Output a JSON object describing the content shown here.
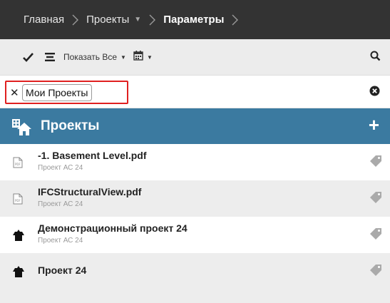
{
  "breadcrumb": {
    "home": "Главная",
    "projects": "Проекты",
    "current": "Параметры"
  },
  "toolbar": {
    "show_all_label": "Показать Все"
  },
  "filter": {
    "chip_label": "Мои Проекты"
  },
  "section": {
    "title": "Проекты",
    "add_symbol": "+"
  },
  "items": [
    {
      "title": "-1. Basement Level.pdf",
      "subtitle": "Проект АС 24",
      "kind": "pdf-icon"
    },
    {
      "title": "IFCStructuralView.pdf",
      "subtitle": "Проект АС 24",
      "kind": "pdf-icon"
    },
    {
      "title": "Демонстрационный проект 24",
      "subtitle": "Проект АС 24",
      "kind": "building-icon"
    },
    {
      "title": "Проект 24",
      "subtitle": "",
      "kind": "building-icon"
    }
  ],
  "colors": {
    "breadcrumb_bg": "#333333",
    "header_accent": "#3b7aa0",
    "highlight_border": "#e02020"
  }
}
